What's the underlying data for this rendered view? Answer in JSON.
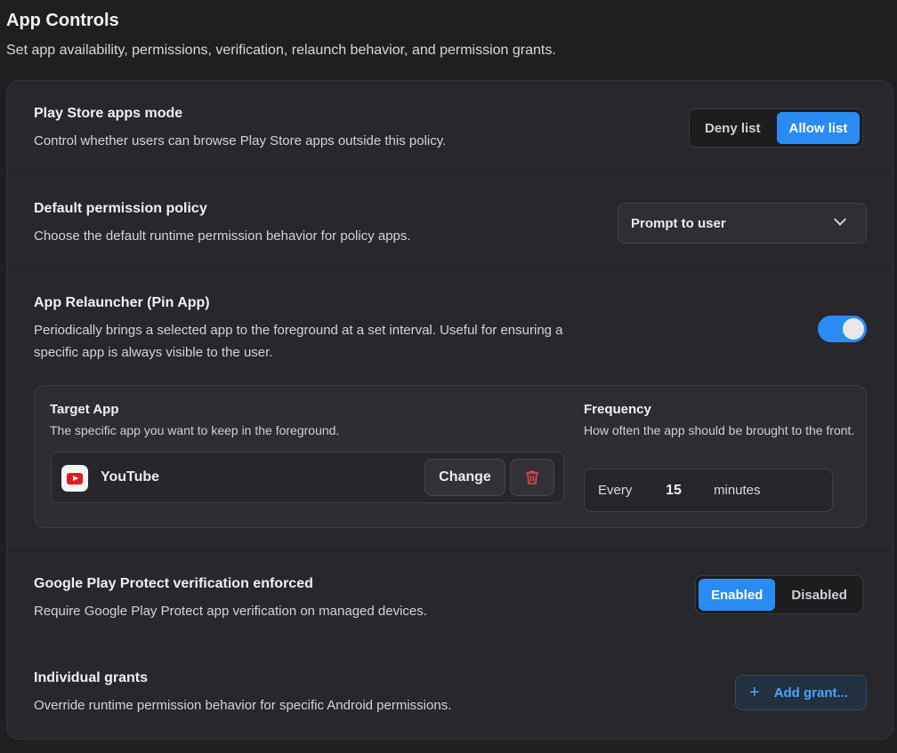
{
  "header": {
    "title": "App Controls",
    "subtitle": "Set app availability, permissions, verification, relaunch behavior, and permission grants."
  },
  "play_store_mode": {
    "title": "Play Store apps mode",
    "description": "Control whether users can browse Play Store apps outside this policy.",
    "options": [
      "Deny list",
      "Allow list"
    ],
    "selected": "Allow list"
  },
  "default_permission": {
    "title": "Default permission policy",
    "description": "Choose the default runtime permission behavior for policy apps.",
    "selected_value": "Prompt to user"
  },
  "relauncher": {
    "title": "App Relauncher (Pin App)",
    "description": "Periodically brings a selected app to the foreground at a set interval. Useful for ensuring a specific app is always visible to the user.",
    "enabled": true,
    "target_app": {
      "label": "Target App",
      "hint": "The specific app you want to keep in the foreground.",
      "app_name": "YouTube",
      "change_label": "Change"
    },
    "frequency": {
      "label": "Frequency",
      "hint": "How often the app should be brought to the front.",
      "prefix": "Every",
      "value": "15",
      "unit": "minutes"
    }
  },
  "play_protect": {
    "title": "Google Play Protect verification enforced",
    "description": "Require Google Play Protect app verification on managed devices.",
    "options": [
      "Enabled",
      "Disabled"
    ],
    "selected": "Enabled"
  },
  "individual_grants": {
    "title": "Individual grants",
    "description": "Override runtime permission behavior for specific Android permissions.",
    "add_label": "Add grant..."
  },
  "colors": {
    "accent": "#2a8cf3",
    "background": "#1f1f22",
    "card": "#28282c",
    "danger": "#e5484d"
  }
}
